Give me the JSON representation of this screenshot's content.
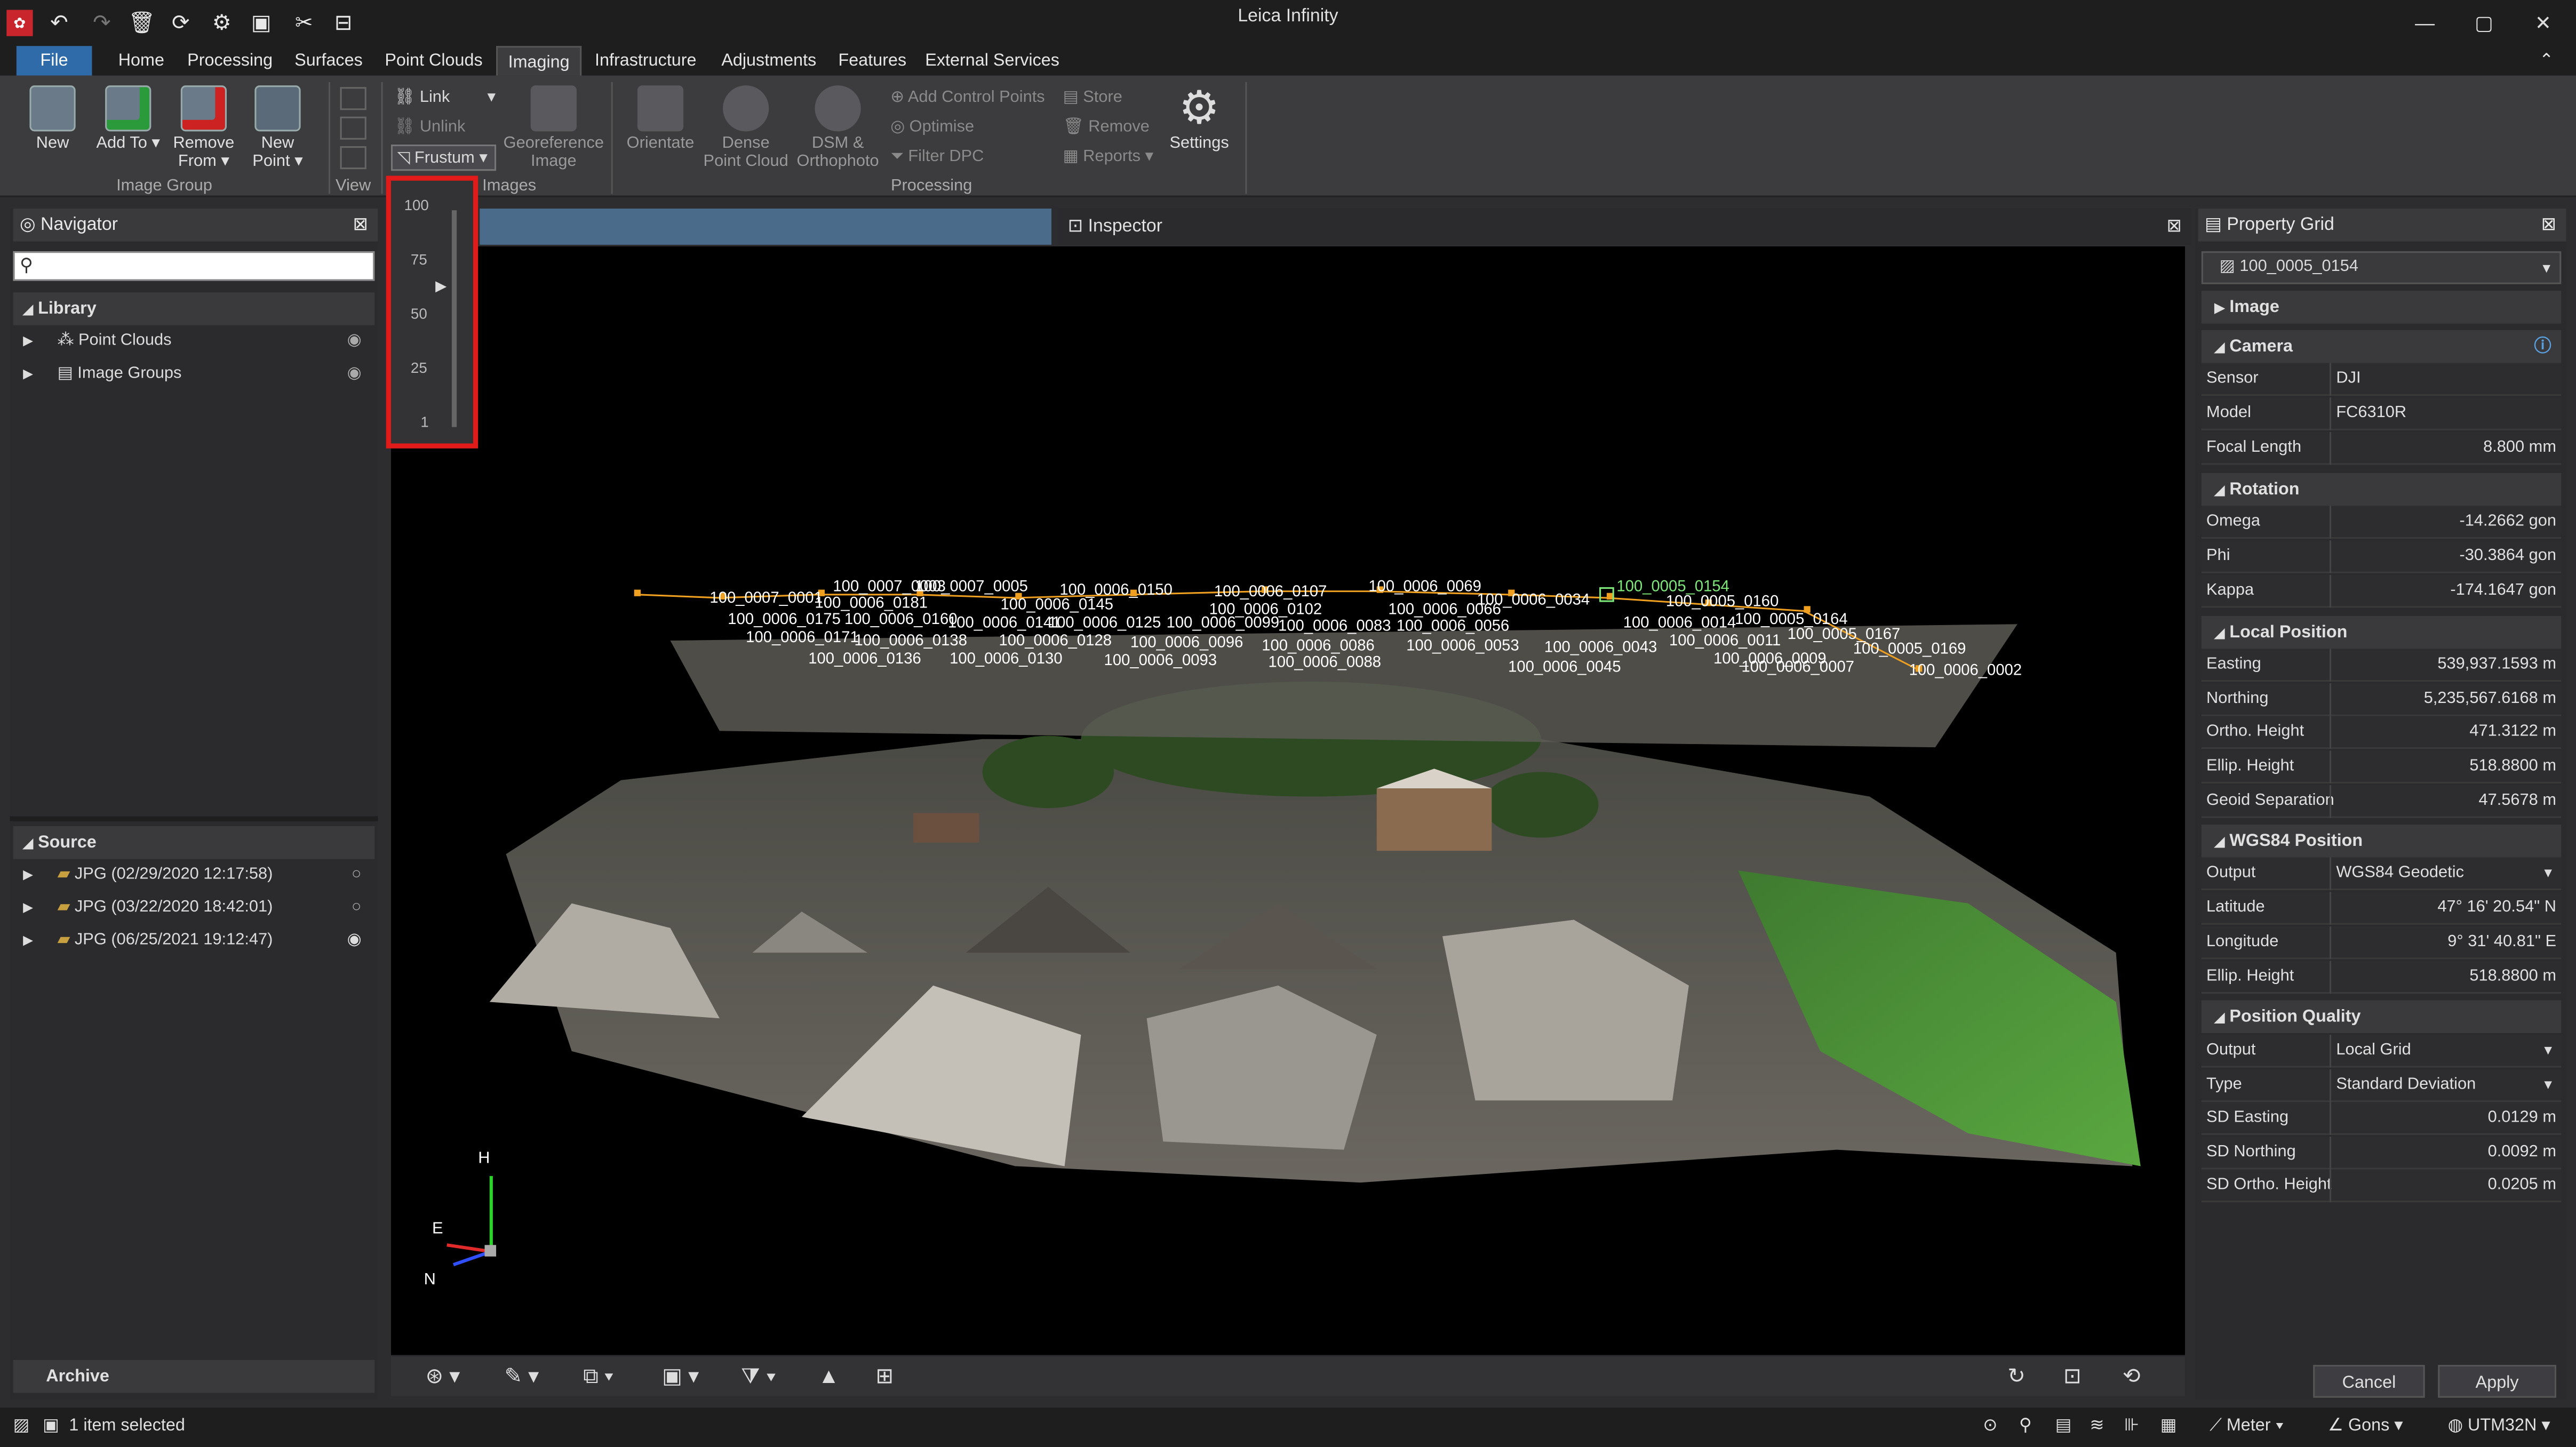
{
  "window": {
    "title": "Leica Infinity"
  },
  "menu_tabs": [
    "File",
    "Home",
    "Processing",
    "Surfaces",
    "Point Clouds",
    "Imaging",
    "Infrastructure",
    "Adjustments",
    "Features",
    "External Services"
  ],
  "ribbon": {
    "new": "New",
    "add_to": "Add To",
    "remove_from": "Remove From",
    "new_point": "New Point",
    "group_image_group": "Image Group",
    "group_view": "View",
    "link": "Link",
    "unlink": "Unlink",
    "frustum": "Frustum",
    "georeference": "Georeference Image",
    "group_images": "Images",
    "orientate": "Orientate",
    "dense": "Dense Point Cloud",
    "dsm": "DSM & Orthophoto",
    "add_control": "Add Control Points",
    "optimise": "Optimise",
    "filter_dpc": "Filter DPC",
    "store": "Store",
    "remove": "Remove",
    "reports": "Reports",
    "settings": "Settings",
    "group_processing": "Processing"
  },
  "frustum_slider": {
    "ticks": [
      "100",
      "75",
      "50",
      "25",
      "1"
    ],
    "value": 50
  },
  "navigator": {
    "title": "Navigator",
    "search_placeholder": "",
    "library": "Library",
    "items": [
      "Point Clouds",
      "Image Groups"
    ],
    "source": "Source",
    "sources": [
      "JPG (02/29/2020 12:17:58)",
      "JPG (03/22/2020 18:42:01)",
      "JPG (06/25/2021 19:12:47)"
    ],
    "archive": "Archive"
  },
  "inspector": {
    "title": "Inspector"
  },
  "viewport": {
    "axis": {
      "h": "H",
      "e": "E",
      "n": "N"
    },
    "camera_labels": [
      "100_0007_0001",
      "100_0007_0003",
      "100_0007_0005",
      "100_0006_0150",
      "100_0006_0107",
      "100_0006_0069",
      "100_0006_0034",
      "100_0005_0154",
      "100_0006_0181",
      "100_0006_0145",
      "100_0006_0102",
      "100_0006_0066",
      "100_0005_0160",
      "100_0006_0175",
      "100_0006_0160",
      "100_0006_0141",
      "100_0006_0125",
      "100_0006_0099",
      "100_0006_0083",
      "100_0006_0056",
      "100_0006_0014",
      "100_0005_0164",
      "100_0006_0171",
      "100_0006_0138",
      "100_0006_0128",
      "100_0006_0096",
      "100_0006_0086",
      "100_0006_0053",
      "100_0006_0043",
      "100_0006_0011",
      "100_0005_0167",
      "100_0006_0136",
      "100_0006_0130",
      "100_0006_0093",
      "100_0006_0088",
      "100_0006_0045",
      "100_0006_0009",
      "100_0005_0169",
      "100_0006_0007",
      "100_0006_0002"
    ]
  },
  "property_grid": {
    "title": "Property Grid",
    "selected": "100_0005_0154",
    "image": "Image",
    "camera": {
      "title": "Camera",
      "sensor_k": "Sensor",
      "sensor_v": "DJI",
      "model_k": "Model",
      "model_v": "FC6310R",
      "focal_k": "Focal Length",
      "focal_v": "8.800 mm"
    },
    "rotation": {
      "title": "Rotation",
      "omega_k": "Omega",
      "omega_v": "-14.2662 gon",
      "phi_k": "Phi",
      "phi_v": "-30.3864 gon",
      "kappa_k": "Kappa",
      "kappa_v": "-174.1647 gon"
    },
    "local": {
      "title": "Local Position",
      "east_k": "Easting",
      "east_v": "539,937.1593 m",
      "north_k": "Northing",
      "north_v": "5,235,567.6168 m",
      "ortho_k": "Ortho. Height",
      "ortho_v": "471.3122 m",
      "ellip_k": "Ellip. Height",
      "ellip_v": "518.8800 m",
      "geoid_k": "Geoid Separation",
      "geoid_v": "47.5678 m"
    },
    "wgs": {
      "title": "WGS84 Position",
      "output_k": "Output",
      "output_v": "WGS84 Geodetic",
      "lat_k": "Latitude",
      "lat_v": "47° 16' 20.54\" N",
      "lon_k": "Longitude",
      "lon_v": "9° 31' 40.81\" E",
      "ellip_k": "Ellip. Height",
      "ellip_v": "518.8800 m"
    },
    "quality": {
      "title": "Position Quality",
      "output_k": "Output",
      "output_v": "Local Grid",
      "type_k": "Type",
      "type_v": "Standard Deviation",
      "sde_k": "SD Easting",
      "sde_v": "0.0129 m",
      "sdn_k": "SD Northing",
      "sdn_v": "0.0092 m",
      "sdo_k": "SD Ortho. Height",
      "sdo_v": "0.0205 m"
    },
    "cancel": "Cancel",
    "apply": "Apply"
  },
  "status": {
    "selected": "1 item selected",
    "unit": "Meter",
    "angle": "Gons",
    "crs": "UTM32N"
  },
  "colors": {
    "accent": "#2f6ba8",
    "highlight": "#e11a1a",
    "camera": "#f0a020",
    "selected_camera": "#7fe87a"
  }
}
